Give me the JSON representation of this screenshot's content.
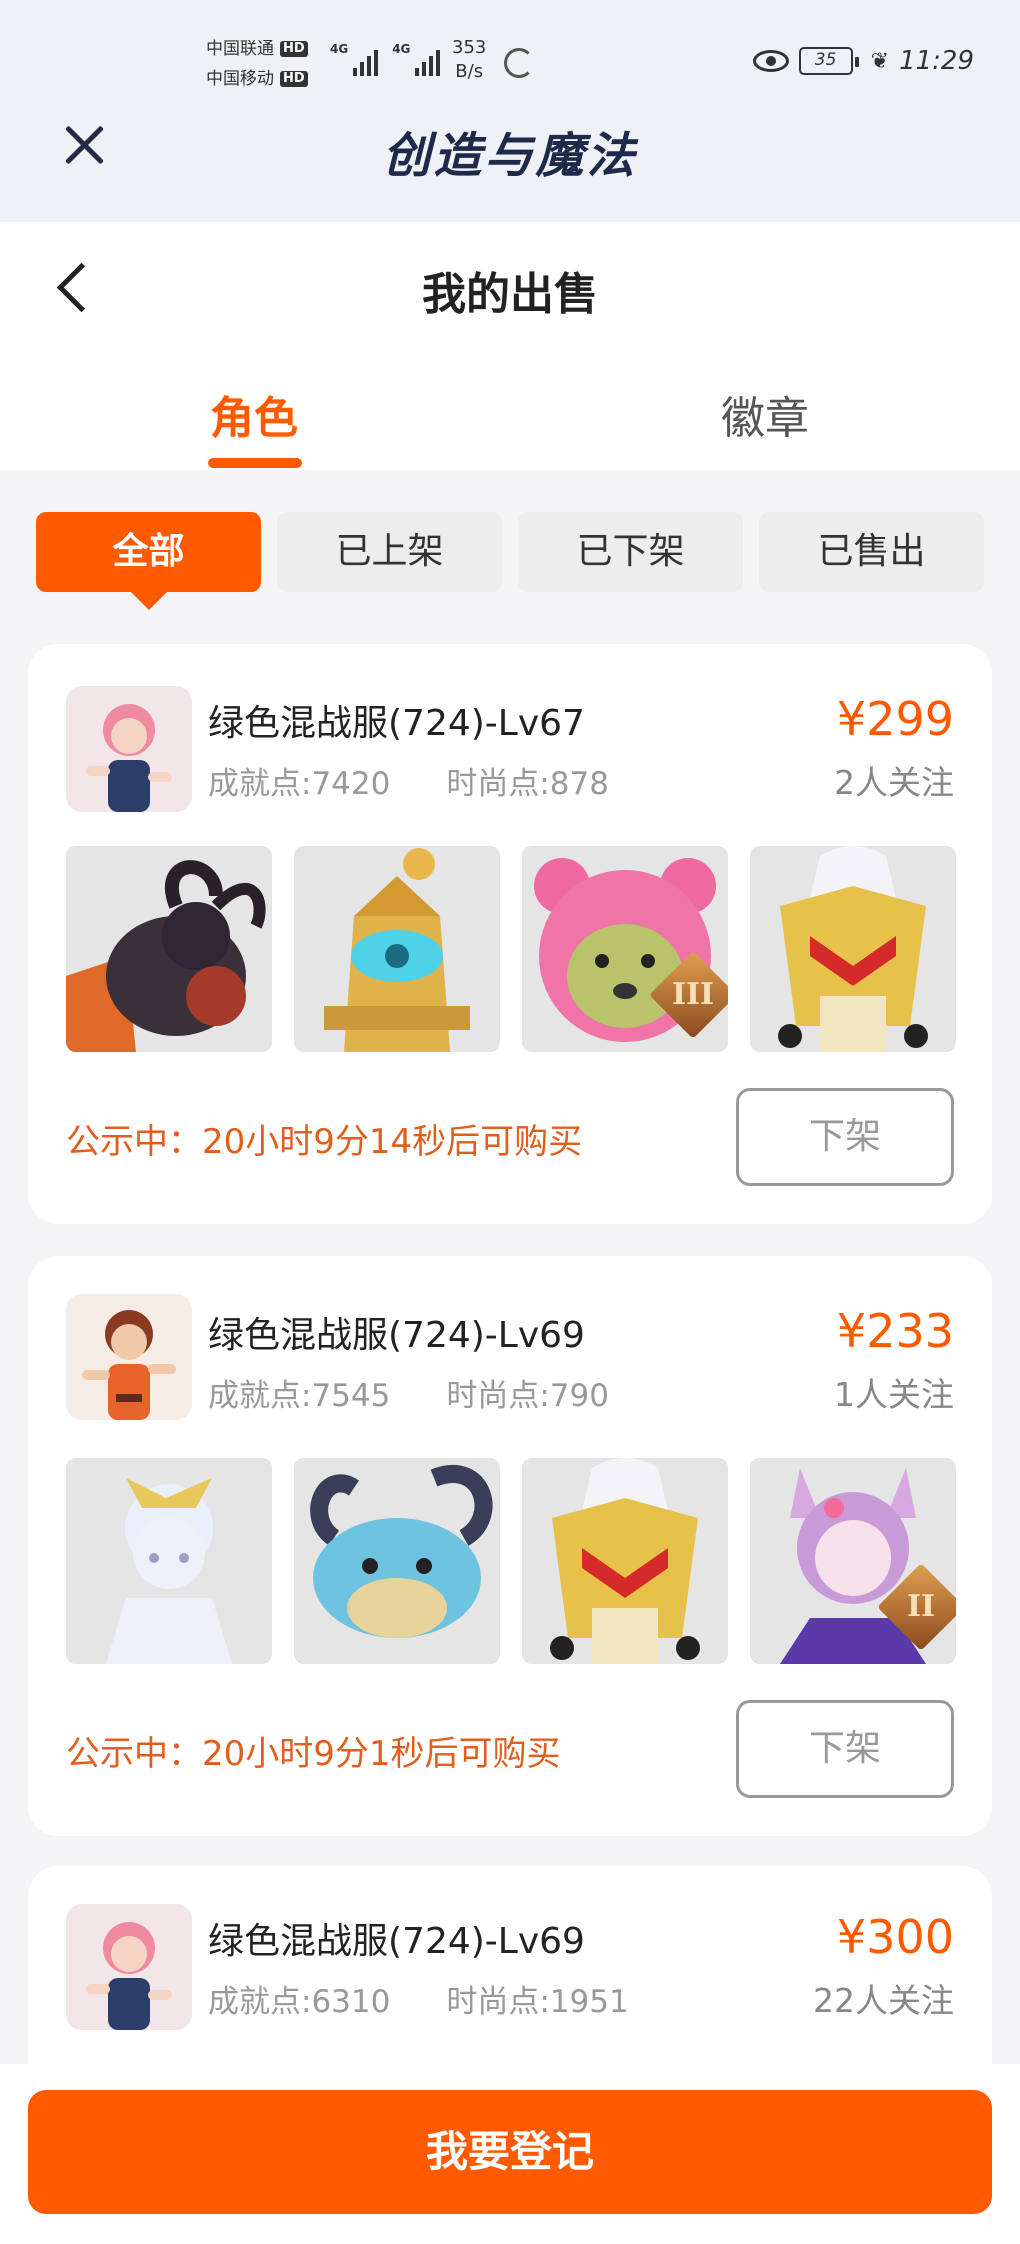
{
  "status_bar": {
    "carrier_1": "中国联通",
    "carrier_2": "中国移动",
    "hd_badge": "HD",
    "network_1": "4G",
    "network_2": "4G",
    "speed_value": "353",
    "speed_unit": "B/s",
    "battery": "35",
    "time": "11:29"
  },
  "app": {
    "title": "创造与魔法"
  },
  "header": {
    "title": "我的出售",
    "tabs": [
      {
        "label": "角色",
        "active": true
      },
      {
        "label": "徽章",
        "active": false
      }
    ]
  },
  "filters": [
    {
      "label": "全部",
      "active": true
    },
    {
      "label": "已上架",
      "active": false
    },
    {
      "label": "已下架",
      "active": false
    },
    {
      "label": "已售出",
      "active": false
    }
  ],
  "listings": [
    {
      "name": "绿色混战服(724)-Lv67",
      "achievement": "成就点:7420",
      "fashion": "时尚点:878",
      "price": "¥299",
      "followers": "2人关注",
      "countdown": "公示中：20小时9分14秒后可购买",
      "action": "下架",
      "tier_badges": [
        "",
        "",
        "III",
        ""
      ]
    },
    {
      "name": "绿色混战服(724)-Lv69",
      "achievement": "成就点:7545",
      "fashion": "时尚点:790",
      "price": "¥233",
      "followers": "1人关注",
      "countdown": "公示中：20小时9分1秒后可购买",
      "action": "下架",
      "tier_badges": [
        "",
        "",
        "",
        "II"
      ]
    },
    {
      "name": "绿色混战服(724)-Lv69",
      "achievement": "成就点:6310",
      "fashion": "时尚点:1951",
      "price": "¥300",
      "followers": "22人关注"
    }
  ],
  "footer": {
    "register_label": "我要登记"
  },
  "colors": {
    "accent": "#ff5a00",
    "countdown": "#e25e1c",
    "muted": "#999999"
  }
}
